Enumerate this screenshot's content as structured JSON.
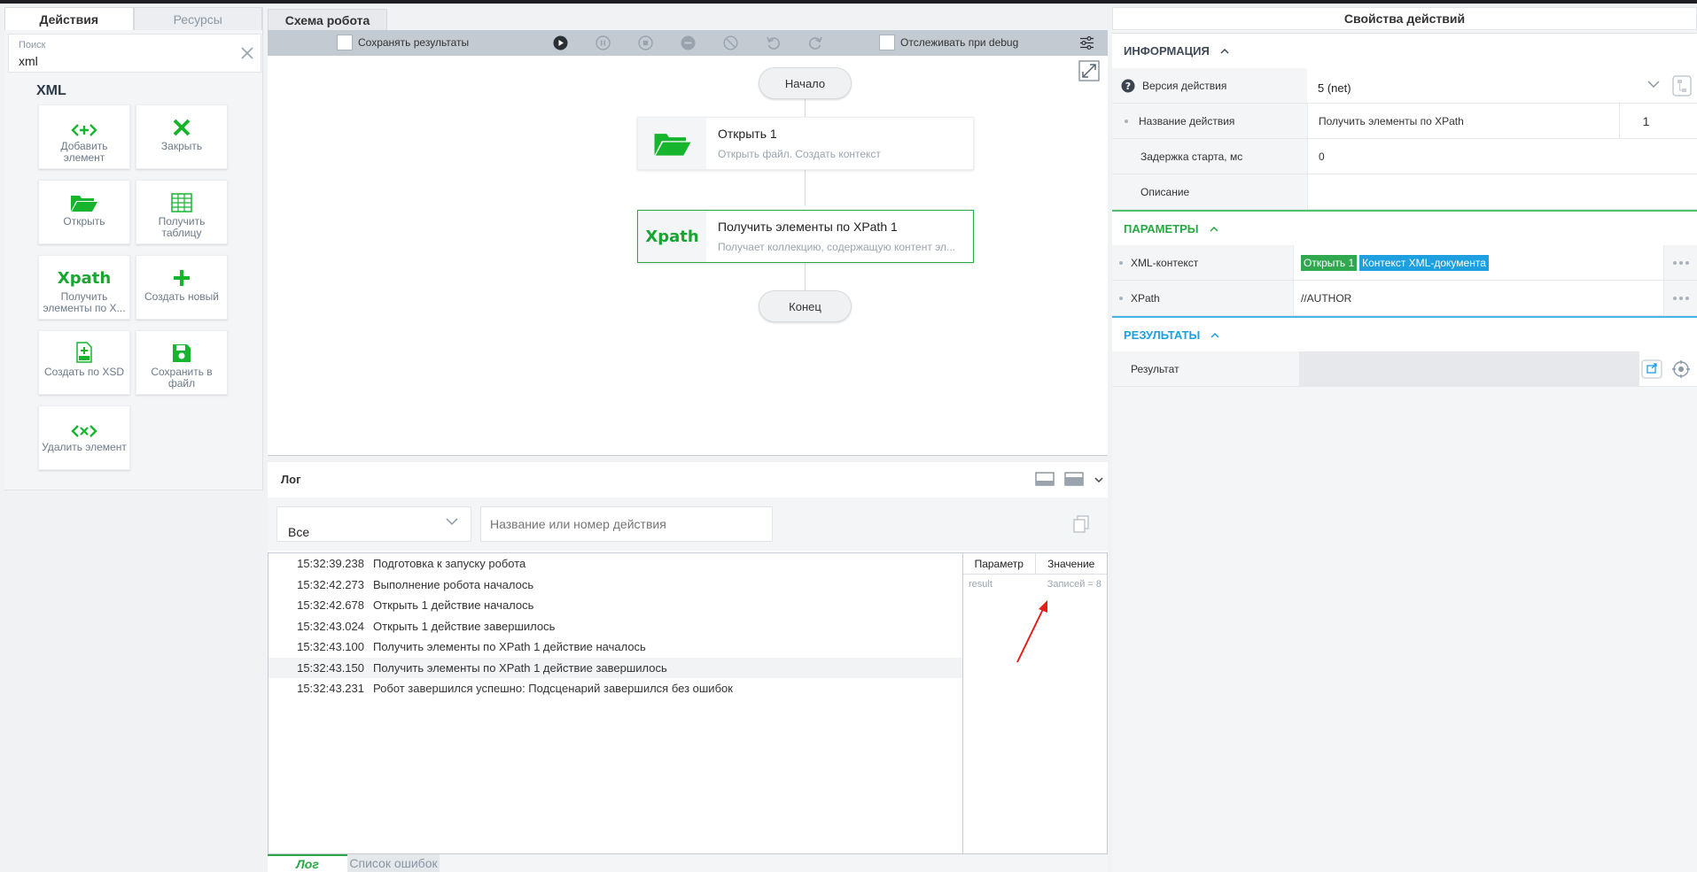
{
  "left": {
    "tabs": [
      "Действия",
      "Ресурсы"
    ],
    "search": {
      "label": "Поиск",
      "value": "xml"
    },
    "group": "XML",
    "tiles": [
      {
        "label": "Добавить элемент",
        "icon": "add-element-icon"
      },
      {
        "label": "Закрыть",
        "icon": "close-x-icon"
      },
      {
        "label": "Открыть",
        "icon": "folder-open-icon"
      },
      {
        "label": "Получить таблицу",
        "icon": "get-table-icon"
      },
      {
        "label": "Получить элементы по X...",
        "icon": "xpath-icon",
        "icon_text": "Xpath"
      },
      {
        "label": "Создать новый",
        "icon": "plus-icon"
      },
      {
        "label": "Создать по XSD",
        "icon": "xsd-file-icon"
      },
      {
        "label": "Сохранить в файл",
        "icon": "save-icon"
      },
      {
        "label": "Удалить элемент",
        "icon": "delete-element-icon"
      }
    ]
  },
  "schema": {
    "tab": "Схема робота",
    "save_results": "Сохранять результаты",
    "track_debug": "Отслеживать при debug",
    "start": "Начало",
    "end": "Конец",
    "nodes": [
      {
        "title": "Открыть  1",
        "desc": "Открыть файл. Создать контекст"
      },
      {
        "title": "Получить элементы по XPath  1",
        "desc": "Получает коллекцию, содержащую контент эл...",
        "icon_text": "Xpath"
      }
    ]
  },
  "log": {
    "title": "Лог",
    "filter_value": "Все",
    "name_placeholder": "Название или номер действия",
    "rows": [
      {
        "time": "15:32:39.238",
        "text": "Подготовка к запуску робота"
      },
      {
        "time": "15:32:42.273",
        "text": "Выполнение робота началось"
      },
      {
        "time": "15:32:42.678",
        "text": "Открыть 1 действие началось"
      },
      {
        "time": "15:32:43.024",
        "text": "Открыть 1 действие завершилось"
      },
      {
        "time": "15:32:43.100",
        "text": "Получить элементы по XPath 1 действие началось"
      },
      {
        "time": "15:32:43.150",
        "text": "Получить элементы по XPath 1 действие завершилось"
      },
      {
        "time": "15:32:43.231",
        "text": "Робот завершился успешно: Подсценарий завершился без ошибок"
      }
    ],
    "param_headers": [
      "Параметр",
      "Значение"
    ],
    "params": [
      {
        "name": "result",
        "value": "Записей = 8"
      }
    ],
    "tabs": [
      "Лог",
      "Список ошибок"
    ]
  },
  "right": {
    "title": "Свойства действий",
    "info": {
      "title": "ИНФОРМАЦИЯ",
      "version_label": "Версия действия",
      "version_value": "5 (net)",
      "name_label": "Название действия",
      "name_value": "Получить элементы по XPath",
      "name_num": "1",
      "delay_label": "Задержка старта, мс",
      "delay_value": "0",
      "desc_label": "Описание",
      "desc_value": ""
    },
    "params": {
      "title": "ПАРАМЕТРЫ",
      "xml_label": "XML-контекст",
      "xml_tag1": "Открыть 1",
      "xml_tag2": "Контекст XML-документа",
      "xpath_label": "XPath",
      "xpath_value": "//AUTHOR"
    },
    "results": {
      "title": "РЕЗУЛЬТАТЫ",
      "result_label": "Результат"
    }
  },
  "colors": {
    "accent_green": "#27a844",
    "accent_blue": "#1e9fe0",
    "arrow_red": "#e0201c"
  }
}
